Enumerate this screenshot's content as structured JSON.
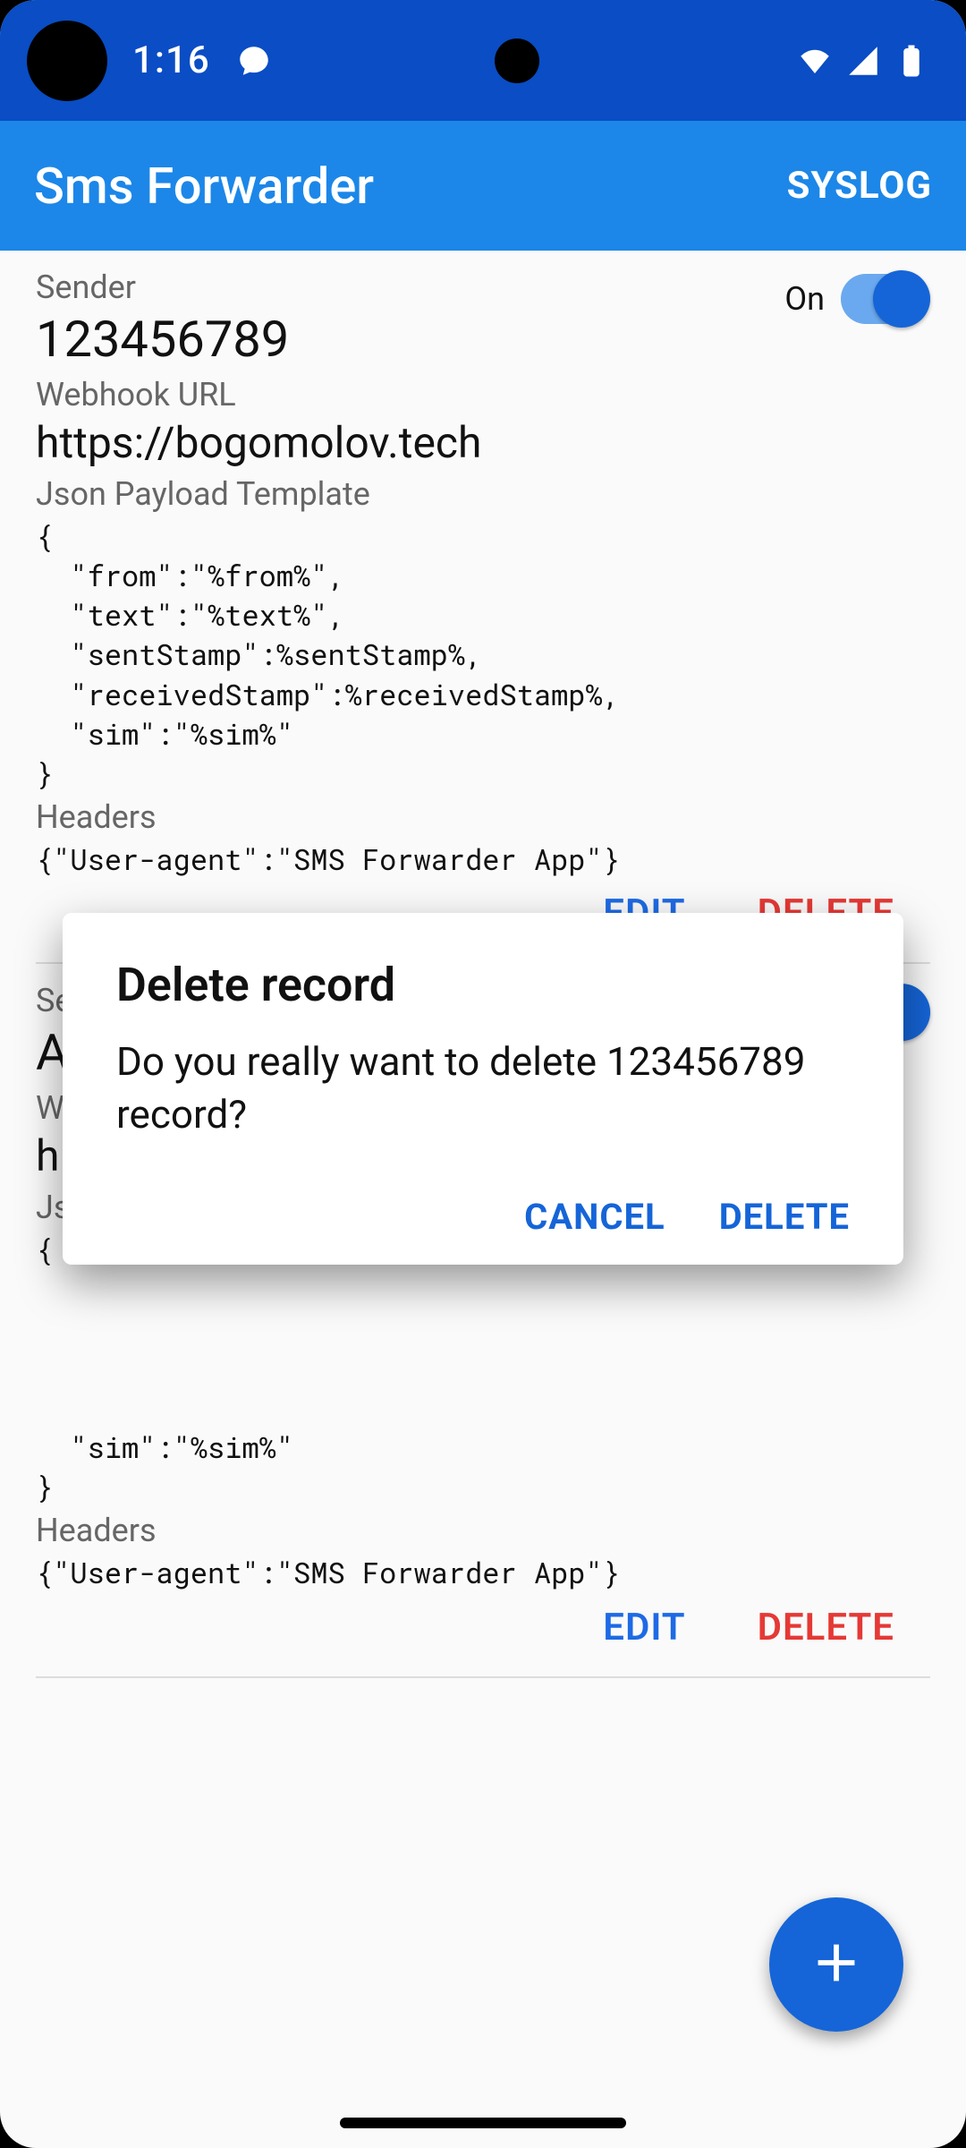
{
  "status": {
    "time": "1:16"
  },
  "appbar": {
    "title": "Sms Forwarder",
    "syslog": "SYSLOG"
  },
  "labels": {
    "sender": "Sender",
    "webhook": "Webhook URL",
    "json_template": "Json Payload Template",
    "headers": "Headers",
    "toggle_on": "On",
    "edit": "EDIT",
    "delete": "DELETE"
  },
  "records": [
    {
      "sender": "123456789",
      "webhook": "https://bogomolov.tech",
      "json": "{\n  \"from\":\"%from%\",\n  \"text\":\"%text%\",\n  \"sentStamp\":%sentStamp%,\n  \"receivedStamp\":%receivedStamp%,\n  \"sim\":\"%sim%\"\n}",
      "headers": "{\"User-agent\":\"SMS Forwarder App\"}",
      "enabled": true
    },
    {
      "sender": "A",
      "webhook": "h",
      "json": "{\n\n\n\n\n  \"sim\":\"%sim%\"\n}",
      "headers": "{\"User-agent\":\"SMS Forwarder App\"}",
      "enabled": true
    }
  ],
  "dialog": {
    "title": "Delete record",
    "message": "Do you really want to delete 123456789 record?",
    "cancel": "CANCEL",
    "confirm": "DELETE"
  }
}
